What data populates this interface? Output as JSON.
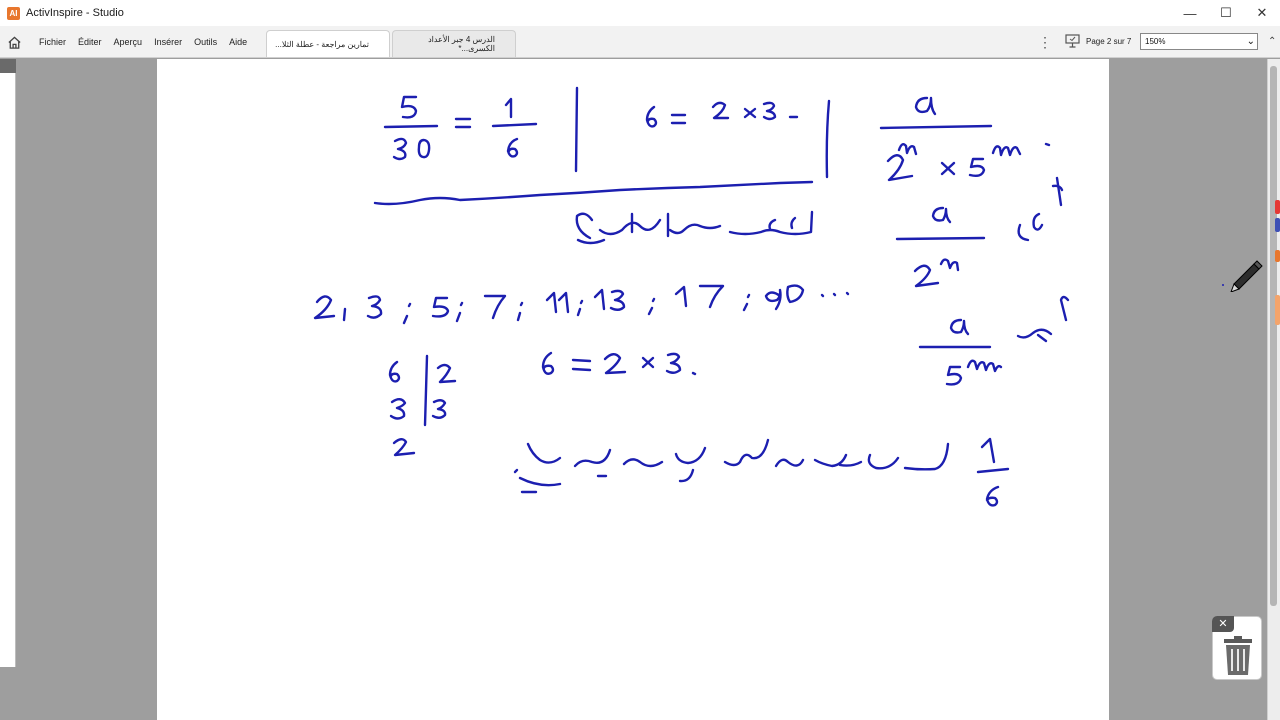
{
  "window": {
    "title": "ActivInspire - Studio",
    "minimize_glyph": "—",
    "maximize_glyph": "☐",
    "close_glyph": "✕"
  },
  "menu": {
    "items": [
      "Fichier",
      "Éditer",
      "Aperçu",
      "Insérer",
      "Outils",
      "Aide"
    ]
  },
  "tabs": [
    {
      "label": "تمارين مراجعة - عطلة الثلا...",
      "active": true
    },
    {
      "label": "الدرس 4 جبر الأعداد الكسرى...*",
      "active": false
    }
  ],
  "toolbar": {
    "page_label": "Page 2 sur 7",
    "zoom_value": "150%"
  },
  "colors": {
    "ink": "#1c1fb0",
    "accent_orange": "#e8772e",
    "mark_red": "#e53935",
    "mark_blue": "#3f51b5"
  },
  "icons": {
    "home": "home-icon",
    "more": "kebab-menu-icon",
    "present": "presenter-icon",
    "pen": "pen-icon",
    "trash": "trash-icon"
  }
}
